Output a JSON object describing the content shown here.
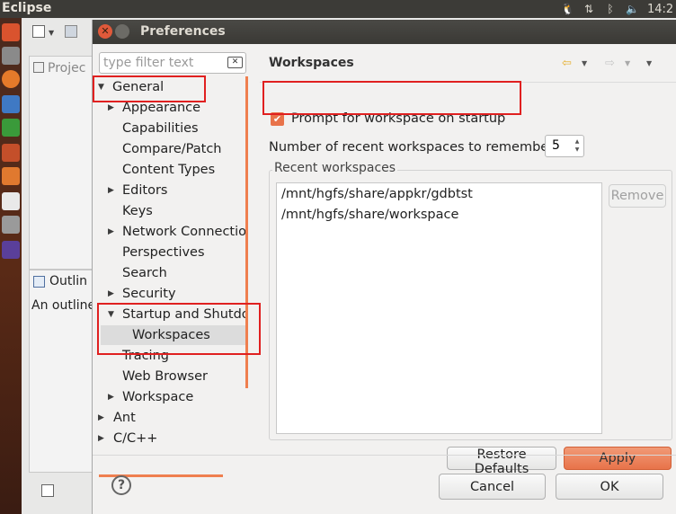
{
  "topbar": {
    "app_title": "Eclipse",
    "clock": "14:2"
  },
  "eclipse": {
    "project_view_title": "Projec",
    "outline_title": "Outlin",
    "outline_text": "An outline"
  },
  "dialog": {
    "title": "Preferences",
    "filter": {
      "placeholder": "type filter text",
      "value": ""
    },
    "tree": {
      "general": "General",
      "appearance": "Appearance",
      "capabilities": "Capabilities",
      "compare_patch": "Compare/Patch",
      "content_types": "Content Types",
      "editors": "Editors",
      "keys": "Keys",
      "network_connections": "Network Connection",
      "perspectives": "Perspectives",
      "search": "Search",
      "security": "Security",
      "startup_shutdown": "Startup and Shutdo",
      "workspaces": "Workspaces",
      "tracing": "Tracing",
      "web_browser": "Web Browser",
      "workspace": "Workspace",
      "ant": "Ant",
      "cpp": "C/C++"
    },
    "page": {
      "title": "Workspaces",
      "prompt_label": "Prompt for workspace on startup",
      "prompt_checked": true,
      "recent_count_label": "Number of recent workspaces to remember:",
      "recent_count_value": "5",
      "recent_group_label": "Recent workspaces",
      "recent_workspaces": [
        "/mnt/hgfs/share/appkr/gdbtst",
        "/mnt/hgfs/share/workspace"
      ],
      "remove_label": "Remove",
      "restore_defaults_label": "Restore Defaults",
      "apply_label": "Apply"
    },
    "footer": {
      "cancel_label": "Cancel",
      "ok_label": "OK"
    }
  },
  "colors": {
    "accent": "#e8734a",
    "highlight_box": "#e02020",
    "titlebar": "#3c3b37"
  }
}
